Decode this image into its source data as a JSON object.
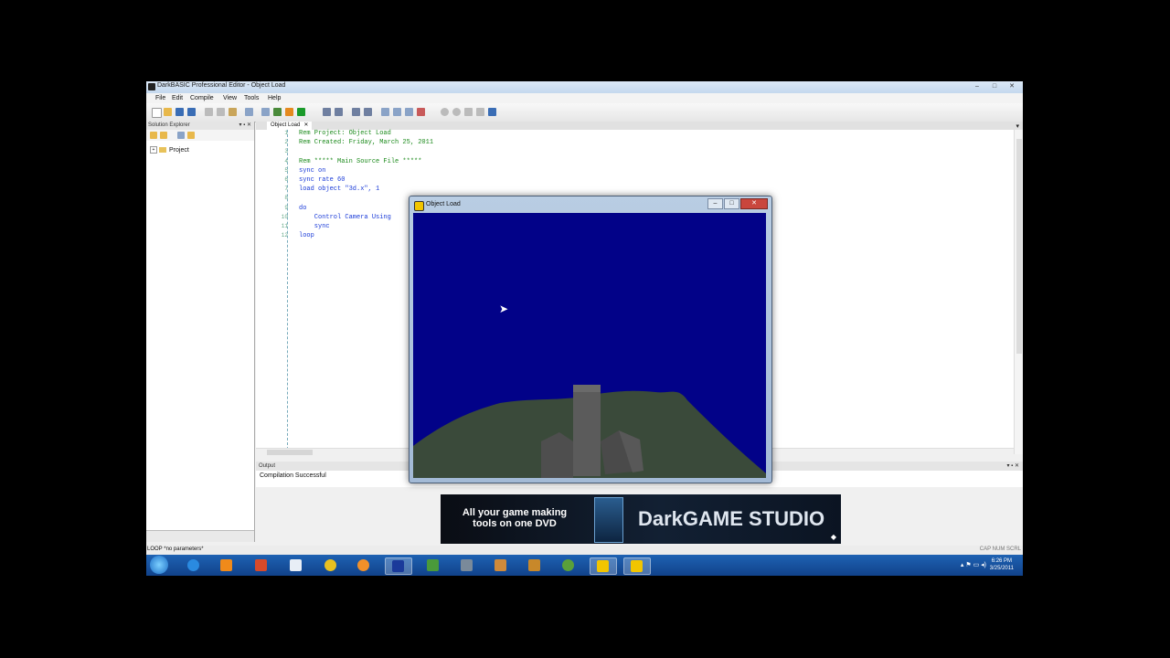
{
  "window": {
    "title": "DarkBASIC Professional Editor - Object Load",
    "controls": [
      "–",
      "□",
      "✕"
    ]
  },
  "menu": [
    "File",
    "Edit",
    "Compile",
    "View",
    "Tools",
    "Help"
  ],
  "solution_explorer": {
    "title": "Solution Explorer",
    "controls": "▾ ▪ ✕",
    "tree_item": "Project",
    "tree_expander": "+"
  },
  "editor": {
    "tab_label": "Object Load",
    "tab_close": "✕",
    "overflow_arrow": "▾",
    "lines": [
      {
        "num": "1",
        "text": "Rem Project: Object Load",
        "kind": "rem"
      },
      {
        "num": "2",
        "text": "Rem Created: Friday, March 25, 2011",
        "kind": "rem"
      },
      {
        "num": "3",
        "text": "",
        "kind": "txt"
      },
      {
        "num": "4",
        "text": "Rem ***** Main Source File *****",
        "kind": "rem"
      },
      {
        "num": "5",
        "text": "sync on",
        "kind": "kw"
      },
      {
        "num": "6",
        "text": "sync rate 60",
        "kind": "kw"
      },
      {
        "num": "7",
        "text": "load object \"3d.x\", 1",
        "kind": "kw"
      },
      {
        "num": "8",
        "text": "",
        "kind": "txt"
      },
      {
        "num": "9",
        "text": "do",
        "kind": "kw"
      },
      {
        "num": "10",
        "text": "    Control Camera Using",
        "kind": "kw"
      },
      {
        "num": "11",
        "text": "    sync",
        "kind": "kw"
      },
      {
        "num": "12",
        "text": "loop",
        "kind": "kw"
      }
    ]
  },
  "output": {
    "title": "Output",
    "controls": "▾ ▪ ✕",
    "message": "Compilation Successful"
  },
  "banner": {
    "tagline": "All your game making tools on one DVD",
    "brand": "DarkGAME STUDIO",
    "arrow": "◆"
  },
  "statusbar": {
    "left": "LOOP *no parameters*",
    "right": "CAP NUM SCRL"
  },
  "taskbar": {
    "time": "6:26 PM",
    "date": "3/25/2011",
    "tray": "▴ ⚑ ▭ ◂)"
  },
  "game_window": {
    "title": "Object Load",
    "controls": [
      "–",
      "□",
      "✕"
    ]
  },
  "colors": {
    "sky": "#020288",
    "terrain": "#3a4a3a",
    "building": "#5a5a5a",
    "taskbar": "#1e62b3",
    "rem_comment": "#1b8a1b",
    "keyword": "#1a3bd8"
  }
}
